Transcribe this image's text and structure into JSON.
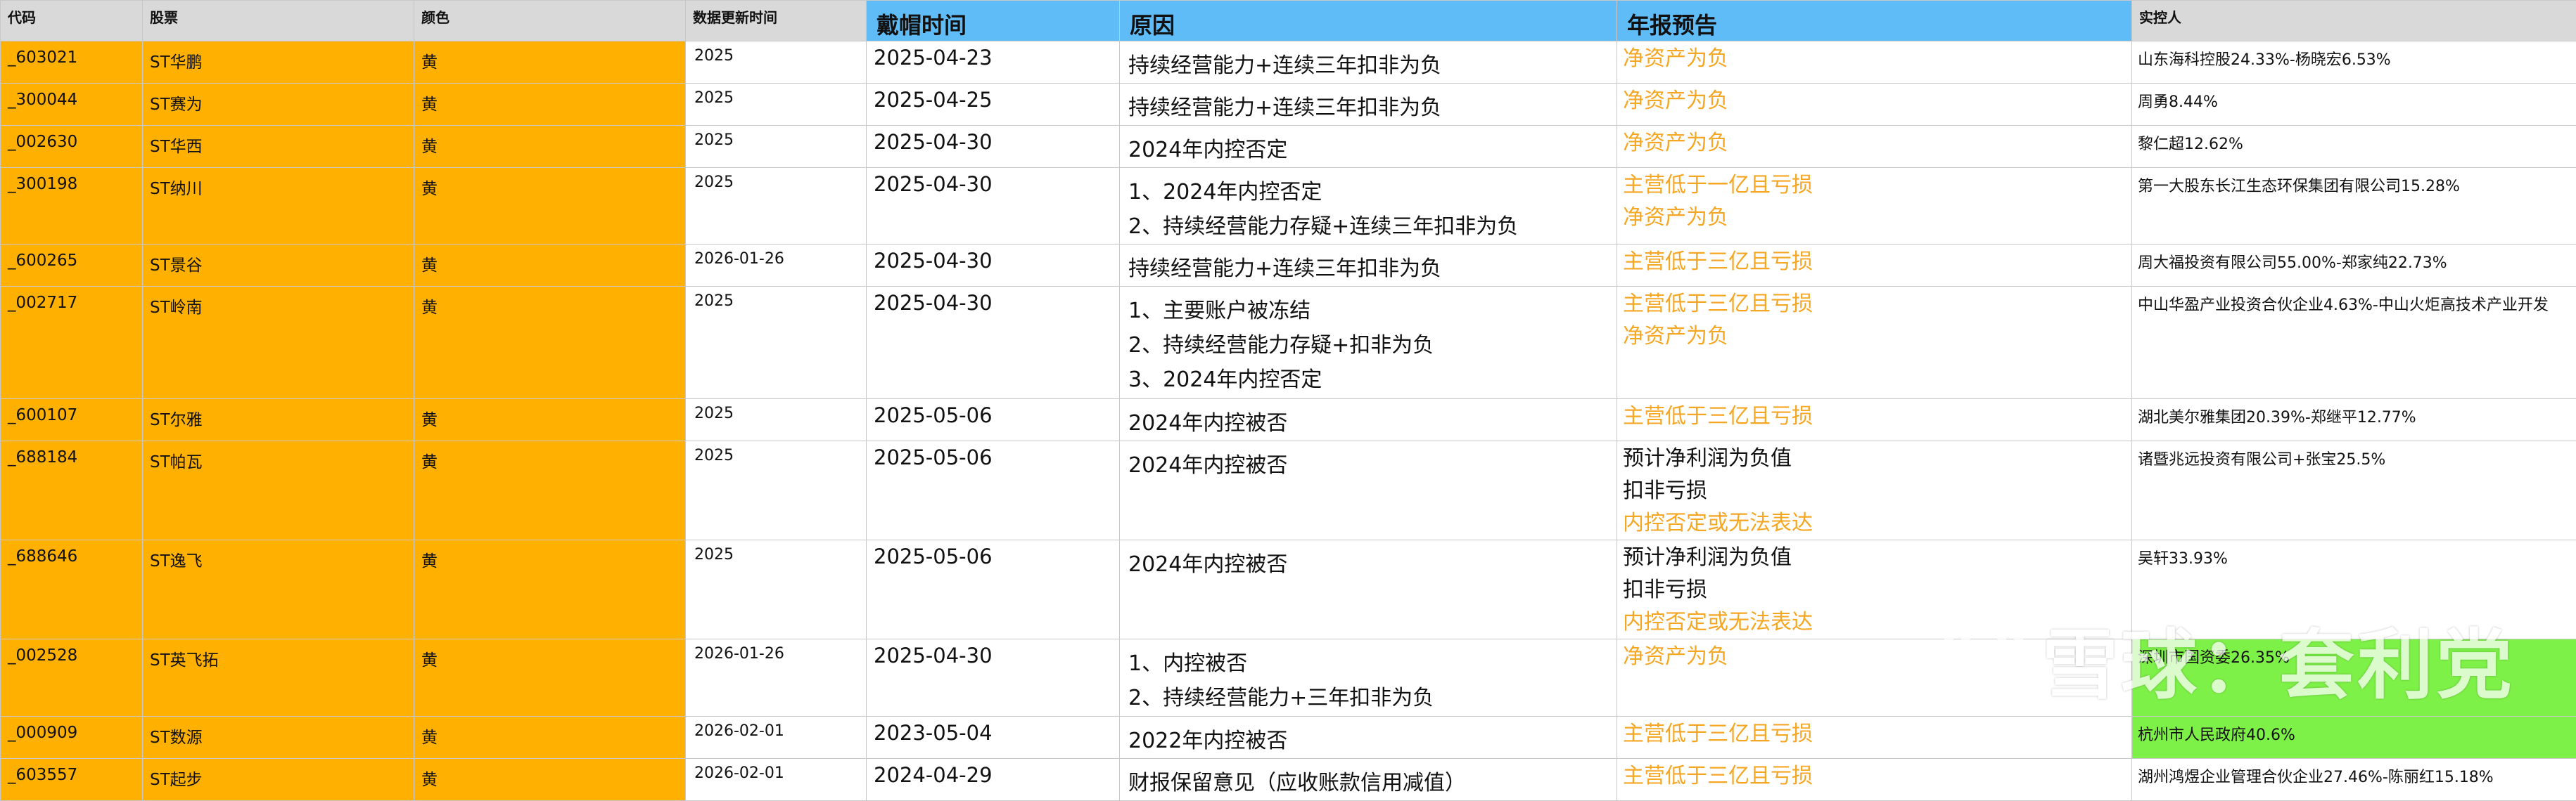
{
  "headers": {
    "code": "代码",
    "stock": "股票",
    "color": "颜色",
    "update": "数据更新时间",
    "cap_date": "戴帽时间",
    "reason": "原因",
    "forecast": "年报预告",
    "owner": "实控人"
  },
  "rows": [
    {
      "code": "_603021",
      "stock": "ST华鹏",
      "color": "黄",
      "update": "2025",
      "cap_date": "2025-04-23",
      "reason": [
        "持续经营能力+连续三年扣非为负"
      ],
      "forecast": [
        {
          "text": "净资产为负",
          "color": "orange"
        }
      ],
      "owner": "山东海科控股24.33%-杨晓宏6.53%"
    },
    {
      "code": "_300044",
      "stock": "ST赛为",
      "color": "黄",
      "update": "2025",
      "cap_date": "2025-04-25",
      "reason": [
        "持续经营能力+连续三年扣非为负"
      ],
      "forecast": [
        {
          "text": "净资产为负",
          "color": "orange"
        }
      ],
      "owner": "周勇8.44%"
    },
    {
      "code": "_002630",
      "stock": "ST华西",
      "color": "黄",
      "update": "2025",
      "cap_date": "2025-04-30",
      "reason": [
        "2024年内控否定"
      ],
      "forecast": [
        {
          "text": "净资产为负",
          "color": "orange"
        }
      ],
      "owner": "黎仁超12.62%"
    },
    {
      "code": "_300198",
      "stock": "ST纳川",
      "color": "黄",
      "update": "2025",
      "cap_date": "2025-04-30",
      "reason": [
        "1、2024年内控否定",
        "2、持续经营能力存疑+连续三年扣非为负"
      ],
      "forecast": [
        {
          "text": "主营低于一亿且亏损",
          "color": "orange"
        },
        {
          "text": "净资产为负",
          "color": "orange"
        }
      ],
      "owner": "第一大股东长江生态环保集团有限公司15.28%"
    },
    {
      "code": "_600265",
      "stock": "ST景谷",
      "color": "黄",
      "update": "2026-01-26",
      "cap_date": "2025-04-30",
      "reason": [
        "持续经营能力+连续三年扣非为负"
      ],
      "forecast": [
        {
          "text": "主营低于三亿且亏损",
          "color": "orange"
        }
      ],
      "owner": "周大福投资有限公司55.00%-郑家纯22.73%"
    },
    {
      "code": "_002717",
      "stock": "ST岭南",
      "color": "黄",
      "update": "2025",
      "cap_date": "2025-04-30",
      "reason": [
        "1、主要账户被冻结",
        "2、持续经营能力存疑+扣非为负",
        "3、2024年内控否定"
      ],
      "forecast": [
        {
          "text": "主营低于三亿且亏损",
          "color": "orange"
        },
        {
          "text": "净资产为负",
          "color": "orange"
        }
      ],
      "owner": "中山华盈产业投资合伙企业4.63%-中山火炬高技术产业开发"
    },
    {
      "code": "_600107",
      "stock": "ST尔雅",
      "color": "黄",
      "update": "2025",
      "cap_date": "2025-05-06",
      "reason": [
        "2024年内控被否"
      ],
      "forecast": [
        {
          "text": "主营低于三亿且亏损",
          "color": "orange"
        }
      ],
      "owner": "湖北美尔雅集团20.39%-郑继平12.77%"
    },
    {
      "code": "_688184",
      "stock": "ST帕瓦",
      "color": "黄",
      "update": "2025",
      "cap_date": "2025-05-06",
      "reason": [
        "2024年内控被否"
      ],
      "forecast": [
        {
          "text": "预计净利润为负值",
          "color": "black"
        },
        {
          "text": "扣非亏损",
          "color": "black"
        },
        {
          "text": "内控否定或无法表达",
          "color": "orange"
        }
      ],
      "owner": "诸暨兆远投资有限公司+张宝25.5%"
    },
    {
      "code": "_688646",
      "stock": "ST逸飞",
      "color": "黄",
      "update": "2025",
      "cap_date": "2025-05-06",
      "reason": [
        "2024年内控被否"
      ],
      "forecast": [
        {
          "text": "预计净利润为负值",
          "color": "black"
        },
        {
          "text": "扣非亏损",
          "color": "black"
        },
        {
          "text": "内控否定或无法表达",
          "color": "orange"
        }
      ],
      "owner": "吴轩33.93%"
    },
    {
      "code": "_002528",
      "stock": "ST英飞拓",
      "color": "黄",
      "update": "2026-01-26",
      "cap_date": "2025-04-30",
      "reason": [
        "1、内控被否",
        "2、持续经营能力+三年扣非为负"
      ],
      "forecast": [
        {
          "text": "净资产为负",
          "color": "orange"
        }
      ],
      "owner": "深圳市国资委26.35%",
      "owner_highlight": "#7ef148"
    },
    {
      "code": "_000909",
      "stock": "ST数源",
      "color": "黄",
      "update": "2026-02-01",
      "cap_date": "2023-05-04",
      "reason": [
        "2022年内控被否"
      ],
      "forecast": [
        {
          "text": "主营低于三亿且亏损",
          "color": "orange"
        }
      ],
      "owner": "杭州市人民政府40.6%",
      "owner_highlight": "#7ef148"
    },
    {
      "code": "_603557",
      "stock": "ST起步",
      "color": "黄",
      "update": "2026-02-01",
      "cap_date": "2024-04-29",
      "reason": [
        "财报保留意见（应收账款信用减值）"
      ],
      "forecast": [
        {
          "text": "主营低于三亿且亏损",
          "color": "orange"
        }
      ],
      "owner": "湖州鸿煜企业管理合伙企业27.46%-陈丽红15.18%"
    }
  ],
  "colors": {
    "row_fill": "#ffb000",
    "header_gray": "#d9d9d9",
    "header_blue": "#5fbcf7",
    "orange_text": "#f5a623",
    "green_highlight": "#7ef148"
  },
  "watermark": {
    "text": "雪球：套利党",
    "icon": "xueqiu-logo-icon"
  }
}
